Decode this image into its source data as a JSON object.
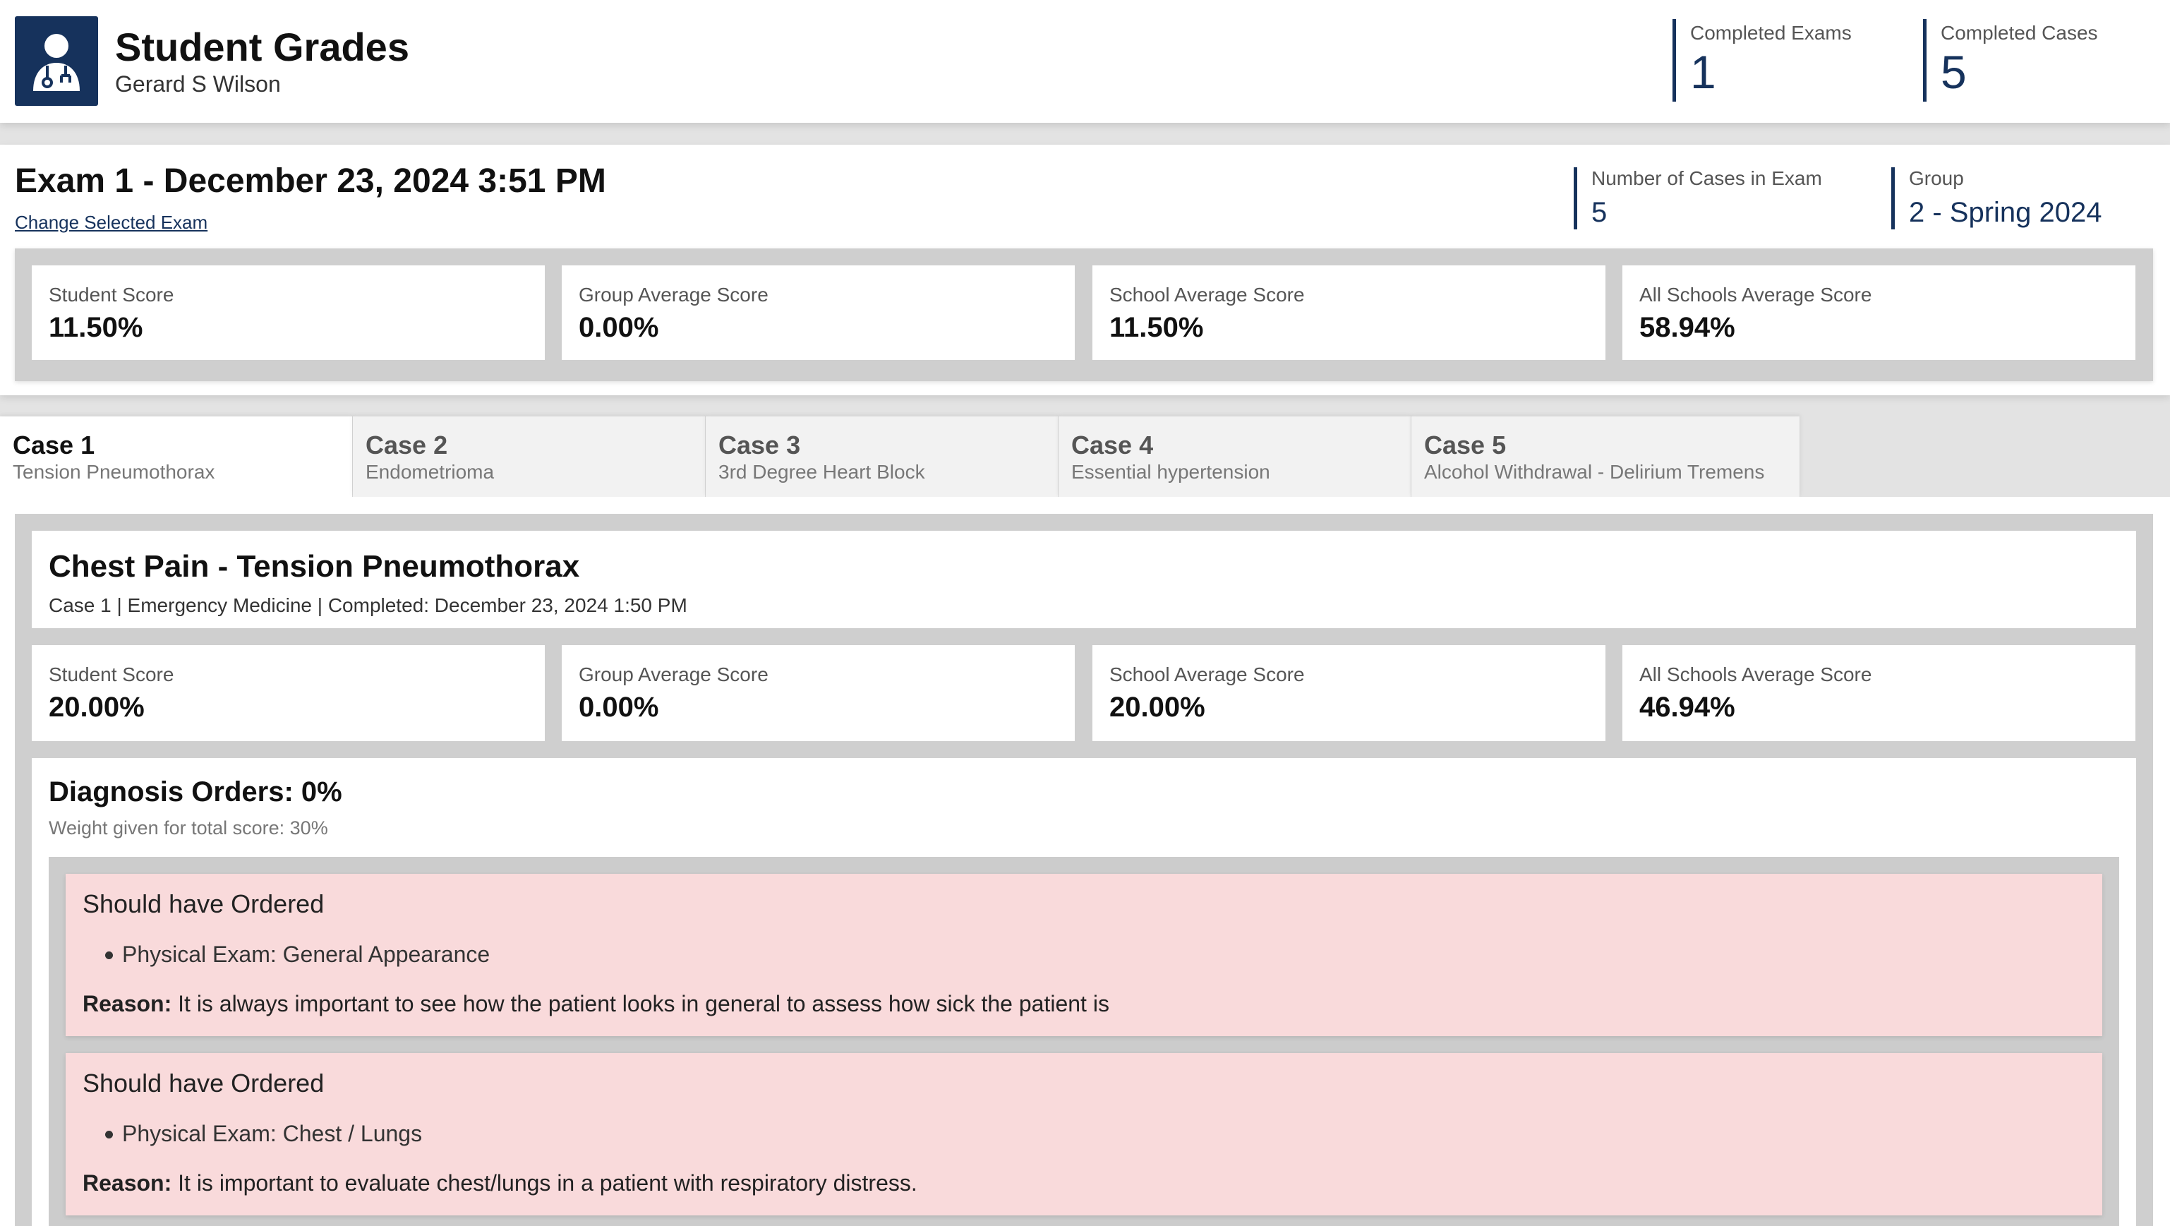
{
  "header": {
    "title": "Student Grades",
    "student_name": "Gerard S Wilson",
    "logo_icon": "doctor-icon",
    "accent_color": "#16325c",
    "stats": [
      {
        "label": "Completed Exams",
        "value": "1"
      },
      {
        "label": "Completed Cases",
        "value": "5"
      }
    ]
  },
  "exam": {
    "title": "Exam 1 - December 23, 2024 3:51 PM",
    "change_link": "Change Selected Exam",
    "stats": [
      {
        "label": "Number of Cases in Exam",
        "value": "5"
      },
      {
        "label": "Group",
        "value": "2 - Spring 2024"
      }
    ],
    "scores": [
      {
        "label": "Student Score",
        "value": "11.50%"
      },
      {
        "label": "Group Average Score",
        "value": "0.00%"
      },
      {
        "label": "School Average Score",
        "value": "11.50%"
      },
      {
        "label": "All Schools Average Score",
        "value": "58.94%"
      }
    ]
  },
  "tabs": [
    {
      "name": "Case 1",
      "subtitle": "Tension Pneumothorax",
      "active": true
    },
    {
      "name": "Case 2",
      "subtitle": "Endometrioma",
      "active": false
    },
    {
      "name": "Case 3",
      "subtitle": "3rd Degree Heart Block",
      "active": false
    },
    {
      "name": "Case 4",
      "subtitle": "Essential hypertension",
      "active": false
    },
    {
      "name": "Case 5",
      "subtitle": "Alcohol Withdrawal - Delirium Tremens",
      "active": false
    }
  ],
  "case": {
    "title": "Chest Pain - Tension Pneumothorax",
    "meta": "Case 1 | Emergency Medicine | Completed: December 23, 2024 1:50 PM",
    "scores": [
      {
        "label": "Student Score",
        "value": "20.00%"
      },
      {
        "label": "Group Average Score",
        "value": "0.00%"
      },
      {
        "label": "School Average Score",
        "value": "20.00%"
      },
      {
        "label": "All Schools Average Score",
        "value": "46.94%"
      }
    ],
    "diagnosis": {
      "title": "Diagnosis Orders: 0%",
      "weight": "Weight given for total score: 30%",
      "highlight_color": "#f9dadb",
      "orders": [
        {
          "title": "Should have Ordered",
          "item": "Physical Exam: General Appearance",
          "reason_label": "Reason:",
          "reason": "It is always important to see how the patient looks in general to assess how sick the patient is"
        },
        {
          "title": "Should have Ordered",
          "item": "Physical Exam: Chest / Lungs",
          "reason_label": "Reason:",
          "reason": "It is important to evaluate chest/lungs in a patient with respiratory distress."
        }
      ]
    }
  }
}
